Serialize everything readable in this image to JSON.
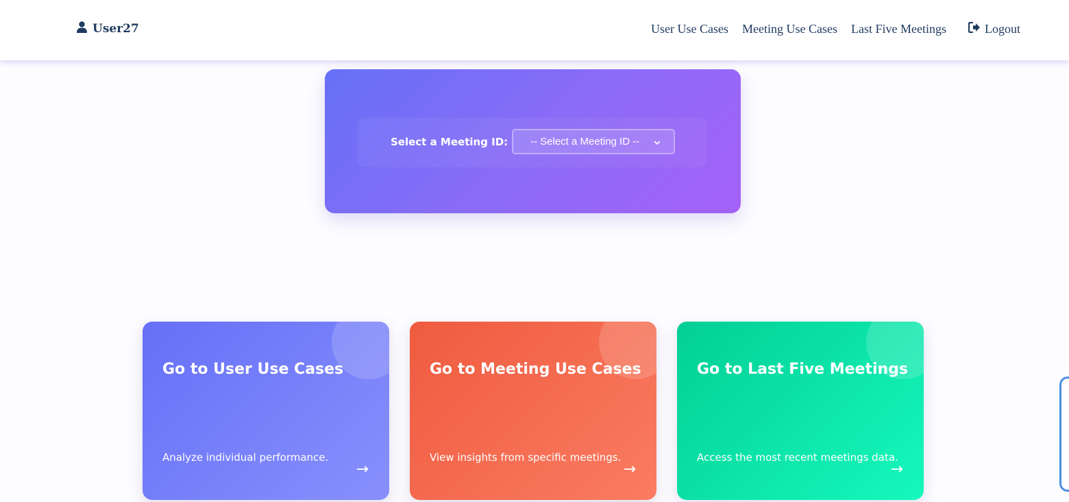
{
  "nav": {
    "user_icon": "user-icon",
    "username": "User27",
    "links": [
      "User Use Cases",
      "Meeting Use Cases",
      "Last Five Meetings"
    ],
    "logout_icon": "sign-out-icon",
    "logout_label": "Logout"
  },
  "selector": {
    "label": "Select a Meeting ID:",
    "selected": "-- Select a Meeting ID --",
    "chevron_icon": "chevron-down-icon"
  },
  "cards": [
    {
      "title": "Go to User Use Cases",
      "description": "Analyze individual performance.",
      "arrow": "→",
      "color": "#6670f7"
    },
    {
      "title": "Go to Meeting Use Cases",
      "description": "View insights from specific meetings.",
      "arrow": "→",
      "color": "#ef5b3f"
    },
    {
      "title": "Go to Last Five Meetings",
      "description": "Access the most recent meetings data.",
      "arrow": "→",
      "color": "#02cf95"
    }
  ],
  "colors": {
    "nav_text": "#1f3a5f",
    "panel_gradient_start": "#6670f7",
    "panel_gradient_end": "#a461f7",
    "side_tab_border": "#4a90e2"
  }
}
